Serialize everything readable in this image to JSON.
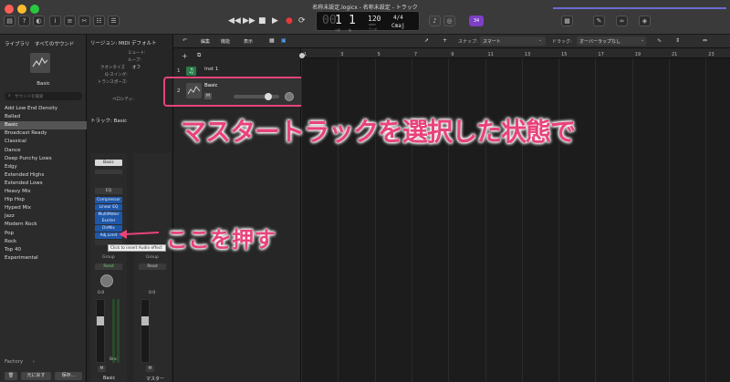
{
  "window": {
    "title": "名称未設定.logicx - 名称未設定 - トラック"
  },
  "transport": {
    "buttons": [
      "◀◀",
      "▶▶",
      "■",
      "▶",
      "●",
      "⟳"
    ]
  },
  "lcd": {
    "bar": "1",
    "beat": "1",
    "bar_label": "小節",
    "beat_label": "拍",
    "tempo": "120",
    "tempo_label": "KEEP",
    "time_sig": "4/4",
    "key": "Cmaj",
    "tempo_sub": "テンポ"
  },
  "badge": {
    "count": "34"
  },
  "library": {
    "tab1": "ライブラリ",
    "tab2": "すべてのサウンド",
    "preset_name": "Basic",
    "search_placeholder": "サウンドを検索",
    "items": [
      "Add Low End Density",
      "Ballad",
      "Basic",
      "Broadcast Ready",
      "Classical",
      "Dance",
      "Deep Punchy Lows",
      "Edgy",
      "Extended Highs",
      "Extended Lows",
      "Heavy Mix",
      "Hip Hop",
      "Hyped Mix",
      "Jazz",
      "Modern Rock",
      "Pop",
      "Rock",
      "Top 40",
      "Experimental"
    ],
    "selected": "Basic",
    "footer_label": "Factory",
    "revert_button": "元に戻す",
    "save_button": "保存..."
  },
  "inspector": {
    "region_header": "リージョン: MIDI デフォルト",
    "params": [
      "ミュート:",
      "ループ:",
      "クオンタイズ",
      "Q-スイング:",
      "トランスポーズ:",
      "ベロシティ:"
    ],
    "quantize_value": "オフ",
    "track_header": "トラック: Basic",
    "preset_label": "Basic",
    "eq_label": "EQ",
    "plugins": [
      "Compressor",
      "Linear EQ",
      "MultiMeter",
      "Exciter",
      "DirMix",
      "Adj.Limit"
    ],
    "tooltip": "Click to insert Audio effect",
    "group_label": "Group",
    "read_label": "Read",
    "pan_value": "0.0",
    "read_label2": "Read",
    "group_label2": "Group",
    "pan_value2": "0.0",
    "bnc_label": "Bnc",
    "strip1_name": "Basic",
    "strip2_name": "マスター",
    "m_label": "M",
    "m_label2": "M"
  },
  "tracks": {
    "edit_menu": "編集",
    "function_menu": "機能",
    "view_menu": "表示",
    "items": [
      {
        "number": "1",
        "name": "Inst 1"
      },
      {
        "number": "2",
        "name": "Basic",
        "m_label": "M"
      }
    ]
  },
  "arrange": {
    "snap_label": "スナップ:",
    "snap_value": "スマート",
    "drag_label": "ドラッグ:",
    "drag_value": "オーバーラップなし",
    "ruler": [
      "1",
      "3",
      "5",
      "7",
      "9",
      "11",
      "13",
      "15",
      "17",
      "19",
      "21",
      "23"
    ]
  },
  "annotations": {
    "main": "マスタートラックを選択した状態で",
    "press": "ここを押す"
  },
  "colors": {
    "highlight": "#e8437a",
    "plugin": "#1f57a8",
    "accent": "#7d3fc6"
  }
}
